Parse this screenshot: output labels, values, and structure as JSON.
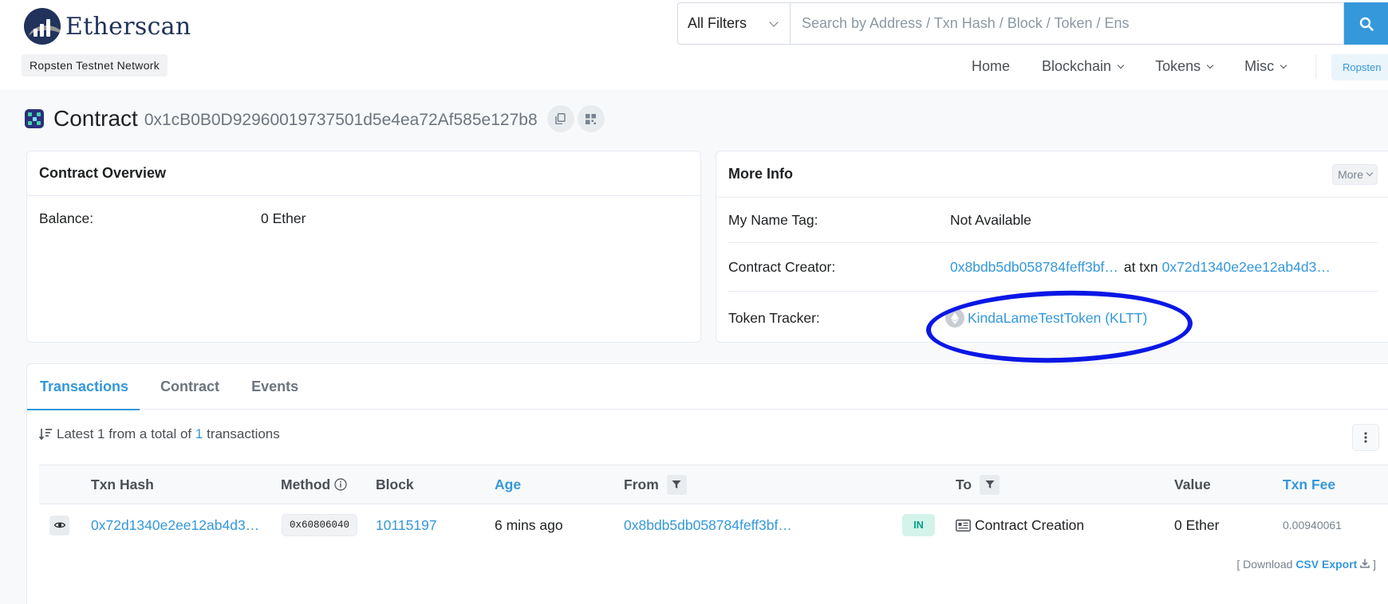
{
  "header": {
    "logo_text": "Etherscan",
    "network": "Ropsten Testnet Network",
    "search": {
      "filter_label": "All Filters",
      "placeholder": "Search by Address / Txn Hash / Block / Token / Ens"
    },
    "nav": [
      "Home",
      "Blockchain",
      "Tokens",
      "Misc"
    ],
    "network_button": "Ropsten"
  },
  "page": {
    "title_label": "Contract",
    "address": "0x1cB0B0D92960019737501d5e4ea72Af585e127b8"
  },
  "overview": {
    "title": "Contract Overview",
    "balance_label": "Balance:",
    "balance_value": "0 Ether"
  },
  "more_info": {
    "title": "More Info",
    "more_button": "More",
    "name_tag_label": "My Name Tag:",
    "name_tag_value": "Not Available",
    "creator_label": "Contract Creator:",
    "creator_address": "0x8bdb5db058784feff3bf…",
    "at_txn": "at txn",
    "creator_txn": "0x72d1340e2ee12ab4d3…",
    "token_tracker_label": "Token Tracker:",
    "token_tracker_value": "KindaLameTestToken (KLTT)"
  },
  "transactions": {
    "tabs": [
      "Transactions",
      "Contract",
      "Events"
    ],
    "summary": {
      "prefix": "Latest 1 from a total of",
      "count": "1",
      "suffix": "transactions"
    },
    "columns": [
      "Txn Hash",
      "Method",
      "Block",
      "Age",
      "From",
      "To",
      "Value",
      "Txn Fee"
    ],
    "rows": [
      {
        "txn_hash": "0x72d1340e2ee12ab4d3…",
        "method": "0x60806040",
        "block": "10115197",
        "age": "6 mins ago",
        "from": "0x8bdb5db058784feff3bf…",
        "direction": "IN",
        "to": "Contract Creation",
        "value": "0 Ether",
        "fee": "0.00940061"
      }
    ],
    "download": {
      "open": "[ Download",
      "link": "CSV Export",
      "close": "]"
    }
  },
  "colors": {
    "link": "#3498db",
    "brand_navy": "#21325b",
    "annotation_ellipse": "#0a17e5",
    "in_badge": "#00a186"
  }
}
